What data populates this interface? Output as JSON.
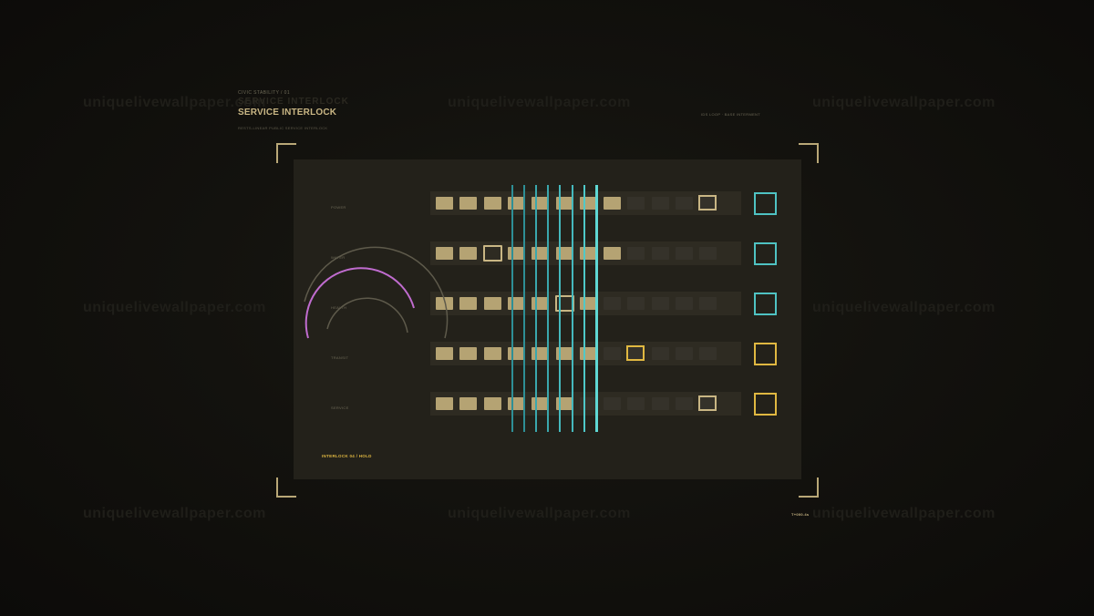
{
  "header": {
    "kicker": "CIVIC STABILITY / 01",
    "title": "SERVICE INTERLOCK",
    "subtitle": "RESTS-LINEAR PUBLIC SERVICE INTERLOCK",
    "right_status": "IDS LOOP · BASE INTERMENT"
  },
  "watermark": "uniquelivewallpaper.com",
  "rows": [
    {
      "label": "POWER",
      "status_color": "#4fc3c3",
      "segments": [
        "on",
        "on",
        "on",
        "on",
        "on",
        "on",
        "on",
        "on",
        "off",
        "off",
        "off",
        "off"
      ],
      "cursor_index": 11,
      "cursor_color": "#c9b684"
    },
    {
      "label": "WATER",
      "status_color": "#4fc3c3",
      "segments": [
        "on",
        "on",
        "sel",
        "on",
        "on",
        "on",
        "on",
        "on",
        "off",
        "off",
        "off",
        "off"
      ],
      "cursor_index": null,
      "cursor_color": "#c9b684"
    },
    {
      "label": "HEALTH",
      "status_color": "#4fc3c3",
      "segments": [
        "on",
        "on",
        "on",
        "on",
        "on",
        "sel",
        "on",
        "off",
        "off",
        "off",
        "off",
        "off"
      ],
      "cursor_index": null,
      "cursor_color": "#c9b684"
    },
    {
      "label": "TRANSIT",
      "status_color": "#e0b841",
      "segments": [
        "on",
        "on",
        "on",
        "on",
        "on",
        "on",
        "on",
        "off",
        "off",
        "off",
        "off",
        "off"
      ],
      "cursor_index": 8,
      "cursor_color": "#e0b841"
    },
    {
      "label": "SERVICE",
      "status_color": "#e0b841",
      "segments": [
        "on",
        "on",
        "on",
        "on",
        "on",
        "on",
        "off",
        "off",
        "off",
        "off",
        "off",
        "off"
      ],
      "cursor_index": 11,
      "cursor_color": "#c9b684"
    }
  ],
  "scan_lines": {
    "count": 8,
    "colors": [
      "#2e8f96",
      "#2e8f96",
      "#3aa7ad",
      "#3aa7ad",
      "#45b9bd",
      "#45b9bd",
      "#4fc9c9",
      "#5fd8d4"
    ]
  },
  "panel_footer": "INTERLOCK 04 / HOLD",
  "timestamp": "T+000.4s",
  "colors": {
    "accent_gold": "#c9b684",
    "accent_amber": "#e0b841",
    "accent_teal": "#4fc3c3",
    "gauge_magenta": "#c06ccf",
    "gauge_grey": "#5e5a4b"
  },
  "icons": {
    "status_indicator": "square-outline-icon",
    "gauge": "arc-gauge-icon"
  }
}
